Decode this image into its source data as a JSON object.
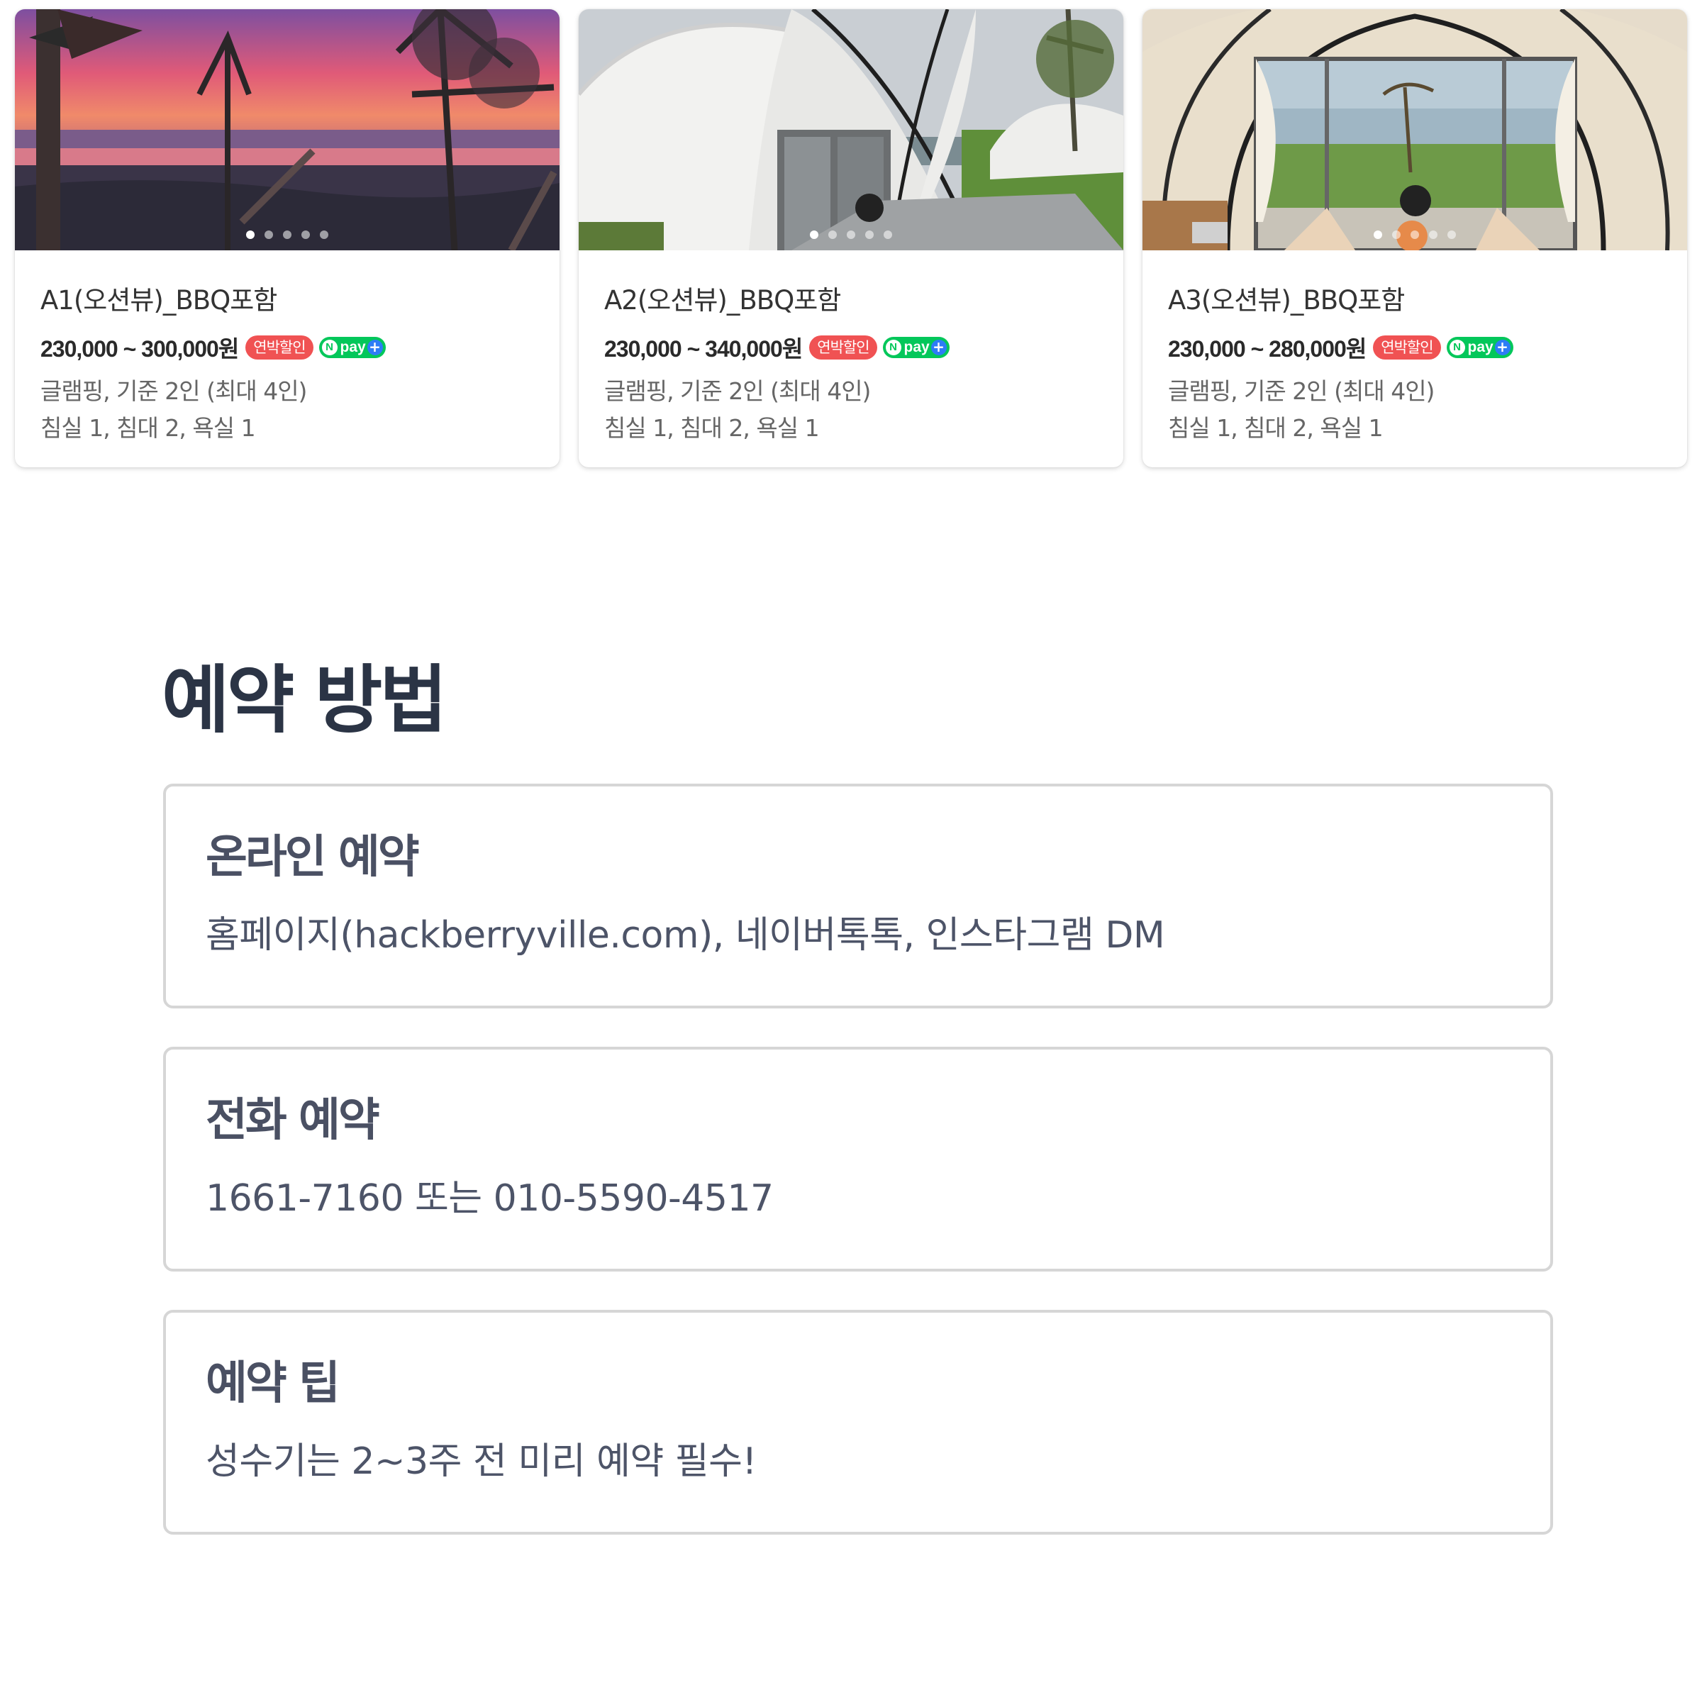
{
  "listings": [
    {
      "title": "A1(오션뷰)_BBQ포함",
      "price": "230,000 ~ 300,000원",
      "sale_badge": "연박할인",
      "npay_badge": "pay",
      "spec_line1": "글램핑, 기준 2인 (최대 4인)",
      "spec_line2": "침실 1, 침대 2, 욕실 1",
      "photo": "sunset-ocean-view",
      "slide_count": 5,
      "active_slide": 1
    },
    {
      "title": "A2(오션뷰)_BBQ포함",
      "price": "230,000 ~ 340,000원",
      "sale_badge": "연박할인",
      "npay_badge": "pay",
      "spec_line1": "글램핑, 기준 2인 (최대 4인)",
      "spec_line2": "침실 1, 침대 2, 욕실 1",
      "photo": "white-dome-tent",
      "slide_count": 5,
      "active_slide": 1
    },
    {
      "title": "A3(오션뷰)_BBQ포함",
      "price": "230,000 ~ 280,000원",
      "sale_badge": "연박할인",
      "npay_badge": "pay",
      "spec_line1": "글램핑, 기준 2인 (최대 4인)",
      "spec_line2": "침실 1, 침대 2, 욕실 1",
      "photo": "tent-interior-ocean",
      "slide_count": 5,
      "active_slide": 1
    }
  ],
  "reservation": {
    "title": "예약 방법",
    "sections": [
      {
        "title": "온라인 예약",
        "text": "홈페이지(hackberryville.com), 네이버톡톡, 인스타그램 DM"
      },
      {
        "title": "전화 예약",
        "text": "1661-7160 또는 010-5590-4517"
      },
      {
        "title": "예약 팁",
        "text": "성수기는 2~3주 전 미리 예약 필수!"
      }
    ]
  },
  "colors": {
    "sale_badge": "#f05253",
    "npay_green": "#03c75a",
    "heading": "#2b3445",
    "box_border": "#d6d6d6"
  }
}
